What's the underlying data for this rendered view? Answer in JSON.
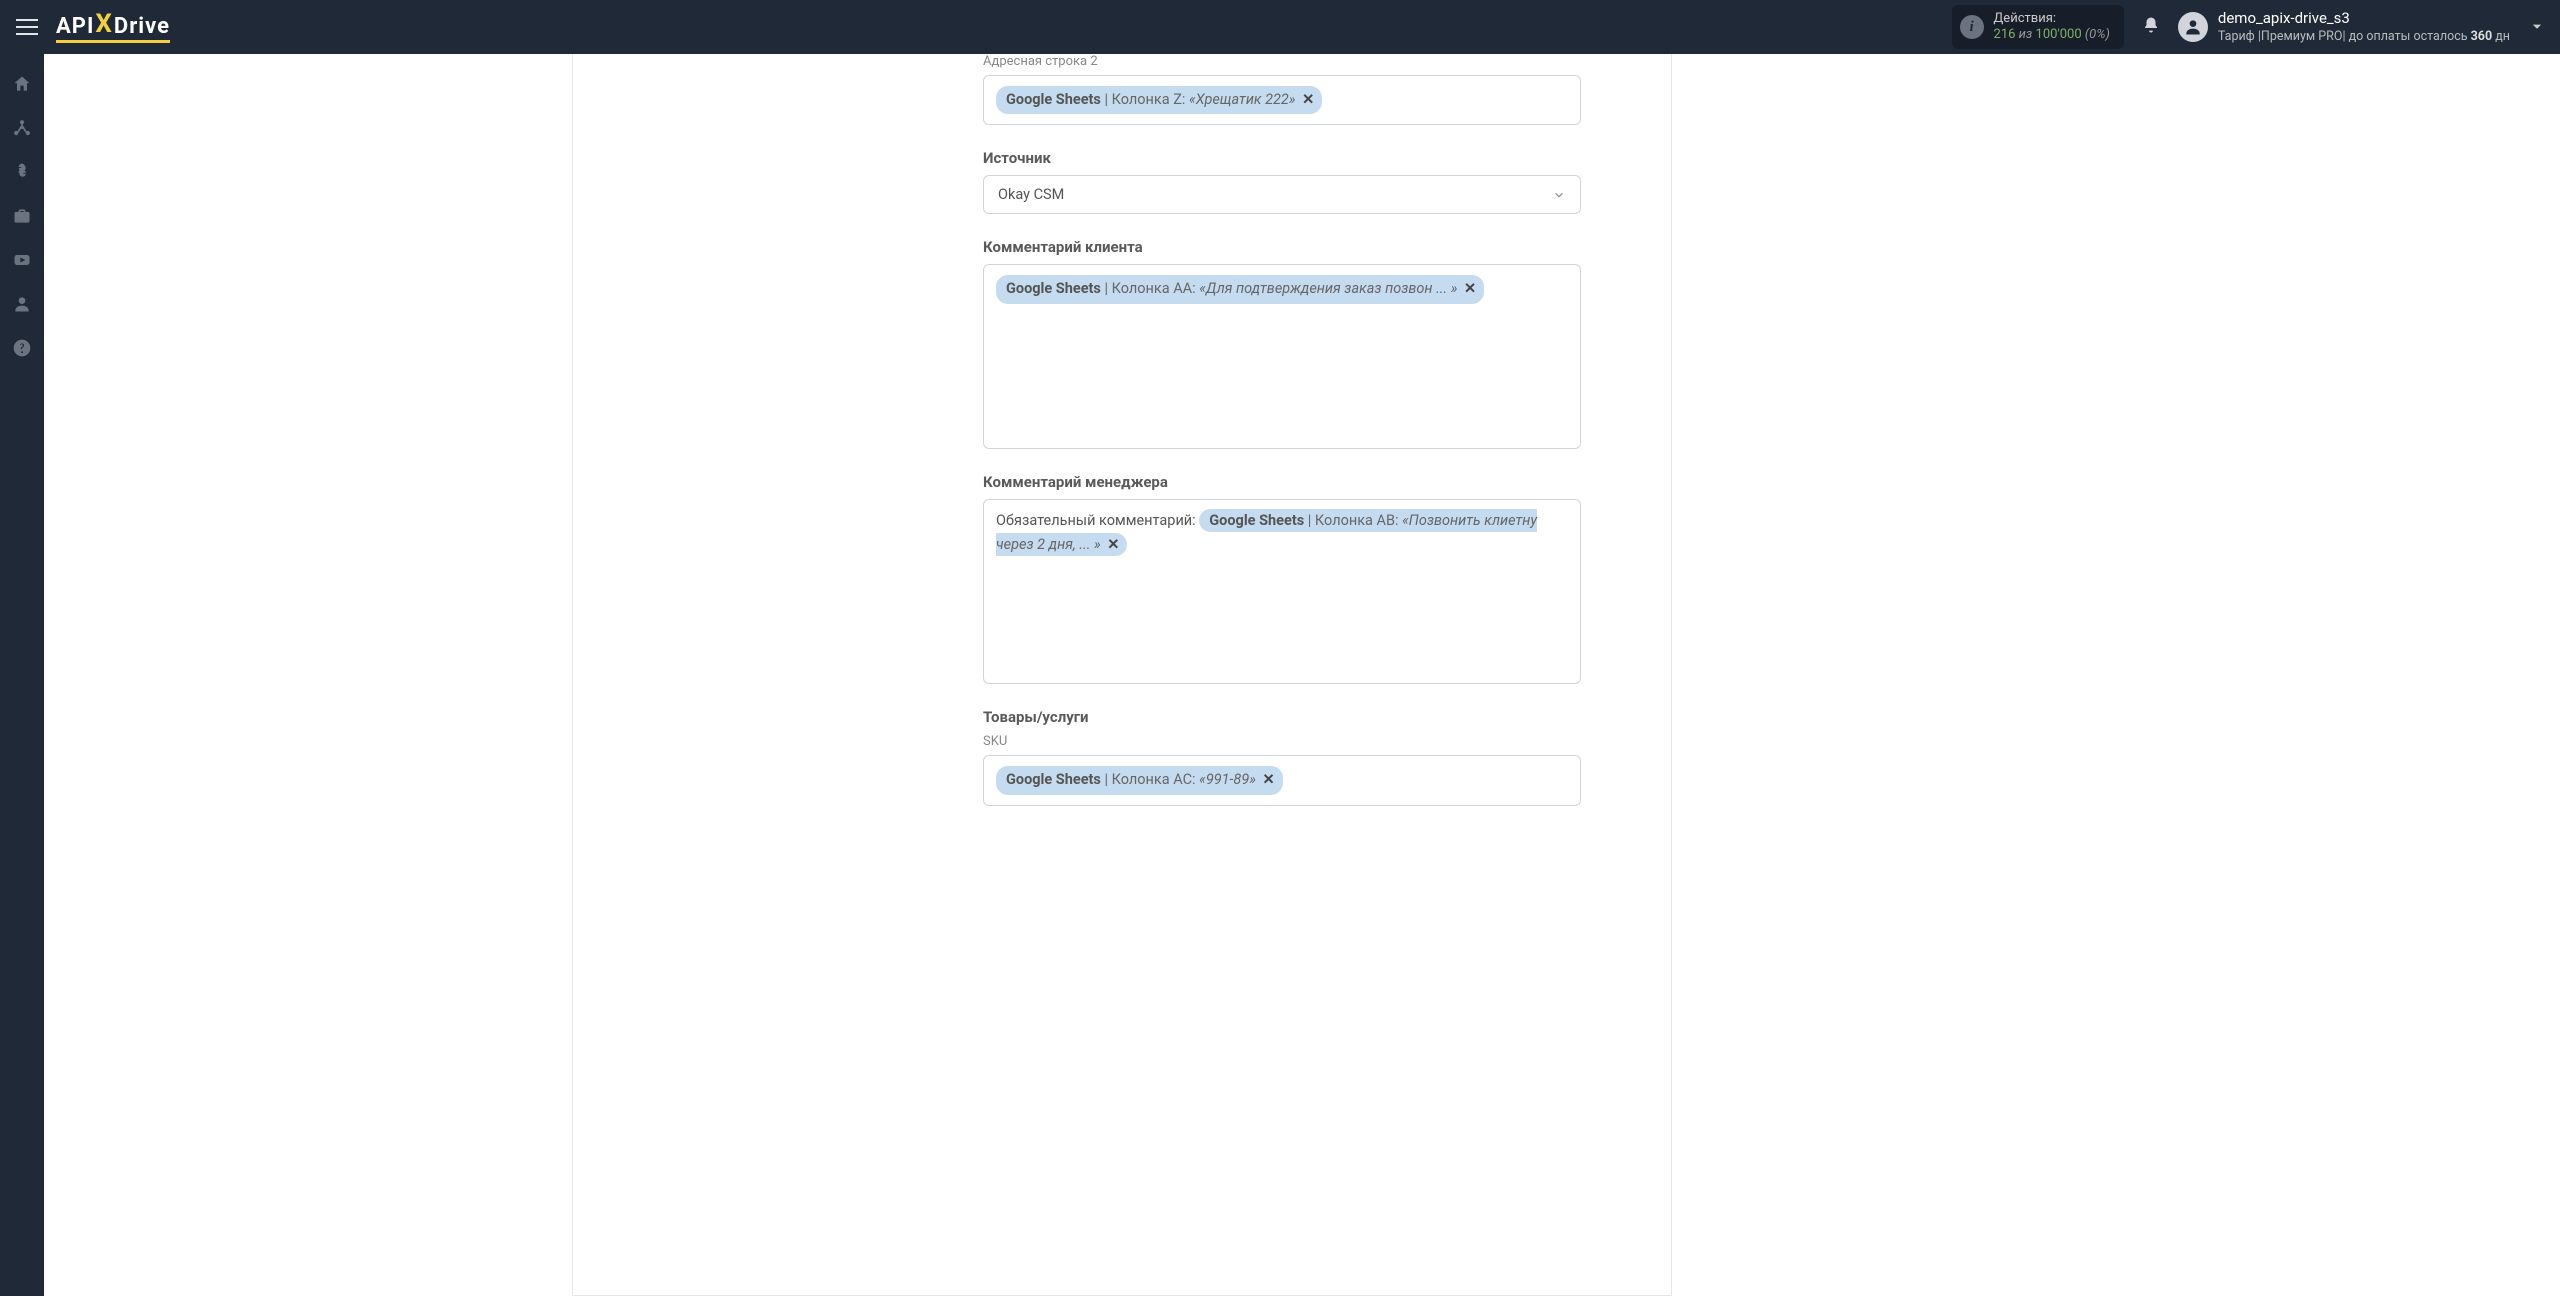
{
  "header": {
    "logo_prefix": "API",
    "logo_suffix": "Drive",
    "actions_label": "Действия:",
    "actions_used": "216",
    "actions_sep": " из ",
    "actions_total": "100'000",
    "actions_pct": " (0%)"
  },
  "user": {
    "name": "demo_apix-drive_s3",
    "tariff_prefix": "Тариф |",
    "tariff_plan": "Премиум PRO",
    "tariff_mid": "| до оплаты осталось ",
    "days": "360",
    "days_suffix": " дн"
  },
  "fields": {
    "address2": {
      "sub_label": "Адресная строка 2",
      "tag_source": "Google Sheets",
      "tag_col": " | Колонка Z: ",
      "tag_sample": "«Хрещатик 222»"
    },
    "source": {
      "label": "Источник",
      "value": "Okay CSM"
    },
    "client_comment": {
      "label": "Комментарий клиента",
      "tag_source": "Google Sheets",
      "tag_col": " | Колонка AA: ",
      "tag_sample": "«Для подтверждения заказ позвон ... »"
    },
    "manager_comment": {
      "label": "Комментарий менеджера",
      "prefix_text": "Обязательный комментарий:  ",
      "tag_source": "Google Sheets",
      "tag_col": " | Колонка AB: ",
      "tag_sample": "«Позвонить клиетну через 2 дня, ... »"
    },
    "products": {
      "label": "Товары/услуги",
      "sub_label": "SKU",
      "tag_source": "Google Sheets",
      "tag_col": " | Колонка AC: ",
      "tag_sample": "«991-89»"
    }
  }
}
